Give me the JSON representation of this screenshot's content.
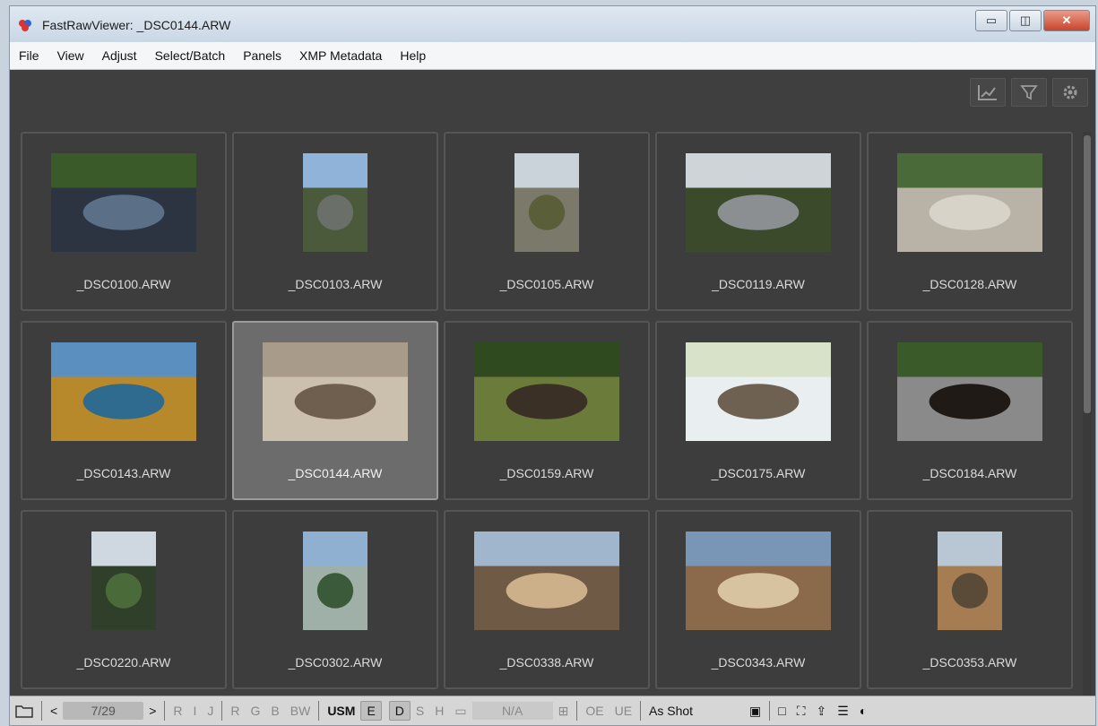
{
  "window": {
    "title": "FastRawViewer: _DSC0144.ARW",
    "controls": [
      "minimize",
      "maximize",
      "close"
    ]
  },
  "menu": [
    "File",
    "View",
    "Adjust",
    "Select/Batch",
    "Panels",
    "XMP Metadata",
    "Help"
  ],
  "top_icons": [
    "histogram-icon",
    "filter-icon",
    "settings-icon"
  ],
  "thumbnails": [
    {
      "name": "_DSC0100.ARW",
      "scene": "river",
      "orientation": "landscape"
    },
    {
      "name": "_DSC0103.ARW",
      "scene": "cliff",
      "orientation": "portrait"
    },
    {
      "name": "_DSC0105.ARW",
      "scene": "canyon",
      "orientation": "portrait"
    },
    {
      "name": "_DSC0119.ARW",
      "scene": "steam",
      "orientation": "landscape"
    },
    {
      "name": "_DSC0128.ARW",
      "scene": "geyser",
      "orientation": "landscape"
    },
    {
      "name": "_DSC0143.ARW",
      "scene": "hotspring",
      "orientation": "landscape"
    },
    {
      "name": "_DSC0144.ARW",
      "scene": "boardwalk",
      "orientation": "landscape",
      "selected": true
    },
    {
      "name": "_DSC0159.ARW",
      "scene": "bison-forest",
      "orientation": "landscape"
    },
    {
      "name": "_DSC0175.ARW",
      "scene": "bison-bright",
      "orientation": "landscape"
    },
    {
      "name": "_DSC0184.ARW",
      "scene": "bison-road",
      "orientation": "landscape"
    },
    {
      "name": "_DSC0220.ARW",
      "scene": "trees",
      "orientation": "portrait"
    },
    {
      "name": "_DSC0302.ARW",
      "scene": "waterfall",
      "orientation": "portrait"
    },
    {
      "name": "_DSC0338.ARW",
      "scene": "dead-trees",
      "orientation": "landscape"
    },
    {
      "name": "_DSC0343.ARW",
      "scene": "terraces",
      "orientation": "landscape"
    },
    {
      "name": "_DSC0353.ARW",
      "scene": "slope",
      "orientation": "portrait"
    }
  ],
  "statusbar": {
    "counter": "7/29",
    "channels": [
      "R",
      "I",
      "J"
    ],
    "rgb": [
      "R",
      "G",
      "B",
      "BW"
    ],
    "usm": "USM",
    "e": "E",
    "d": "D",
    "s": "S",
    "h": "H",
    "na": "N/A",
    "oe": "OE",
    "ue": "UE",
    "wb": "As Shot"
  },
  "colors": {
    "background": "#3f3f3f",
    "tile": "#3d3d3d",
    "selected_tile": "#6c6c6c"
  }
}
